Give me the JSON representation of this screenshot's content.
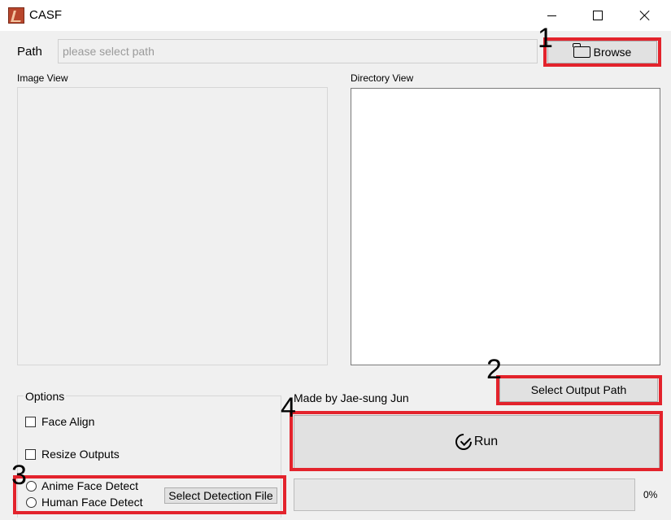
{
  "window": {
    "title": "CASF"
  },
  "path_row": {
    "label": "Path",
    "placeholder": "please select path",
    "value": "",
    "browse_label": "Browse"
  },
  "image_view": {
    "label": "Image View"
  },
  "directory_view": {
    "label": "Directory View"
  },
  "options": {
    "title": "Options",
    "face_align": {
      "label": "Face Align",
      "checked": false
    },
    "resize_outputs": {
      "label": "Resize Outputs",
      "checked": false
    },
    "anime_face_detect": {
      "label": "Anime Face Detect",
      "selected": false
    },
    "human_face_detect": {
      "label": "Human Face Detect",
      "selected": false
    },
    "select_detection_file_label": "Select Detection File"
  },
  "credits": "Made by Jae-sung Jun",
  "select_output_path_label": "Select Output Path",
  "run_label": "Run",
  "progress": {
    "value": 0,
    "label": "0%"
  },
  "annotations": {
    "n1": "1",
    "n2": "2",
    "n3": "3",
    "n4": "4",
    "highlight_color": "#e3232c"
  },
  "icons": {
    "app": "casf-app-icon",
    "browse": "folder-open-icon",
    "run": "check-circle-icon"
  }
}
